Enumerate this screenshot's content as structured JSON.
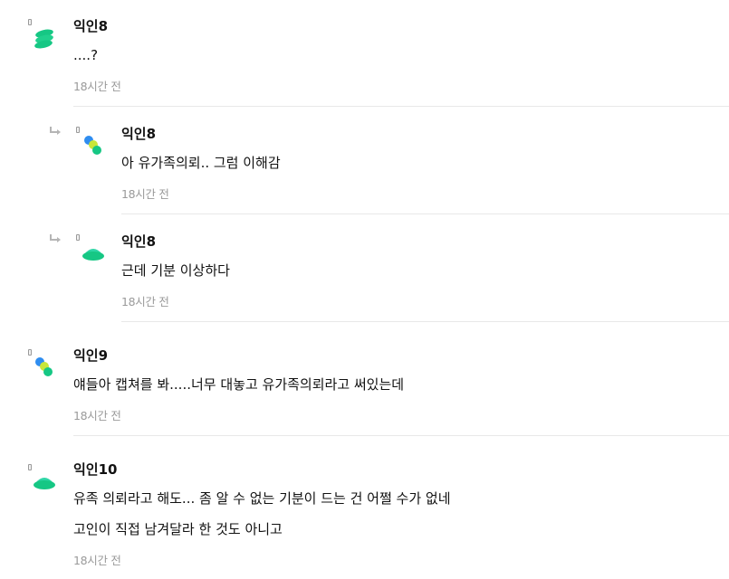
{
  "comments": [
    {
      "author": "익인8",
      "lines": [
        "....?"
      ],
      "time": "18시간 전",
      "avatar_icon": "green-stack-icon",
      "is_reply": false
    },
    {
      "author": "익인8",
      "lines": [
        "아 유가족의뢰.. 그럼 이해감"
      ],
      "time": "18시간 전",
      "avatar_icon": "green-blue-dots-icon",
      "is_reply": true
    },
    {
      "author": "익인8",
      "lines": [
        "근데 기분 이상하다"
      ],
      "time": "18시간 전",
      "avatar_icon": "green-dome-icon",
      "is_reply": true
    },
    {
      "author": "익인9",
      "lines": [
        "얘들아 캡쳐를 봐.....너무 대놓고 유가족의뢰라고 써있는데"
      ],
      "time": "18시간 전",
      "avatar_icon": "green-blue-dots-icon",
      "is_reply": false
    },
    {
      "author": "익인10",
      "lines": [
        "유족 의뢰라고 해도... 좀 알 수 없는 기분이 드는 건 어쩔 수가 없네",
        "고인이 직접 남겨달라 한 것도 아니고"
      ],
      "time": "18시간 전",
      "avatar_icon": "green-dome-icon",
      "is_reply": false
    }
  ],
  "colors": {
    "avatar_green": "#16c784",
    "avatar_mint": "#2fd6a6",
    "avatar_blue": "#2f8df0",
    "avatar_yellow": "#c8e63a",
    "divider": "#e8e8e8",
    "time_text": "#9a9a9a"
  }
}
